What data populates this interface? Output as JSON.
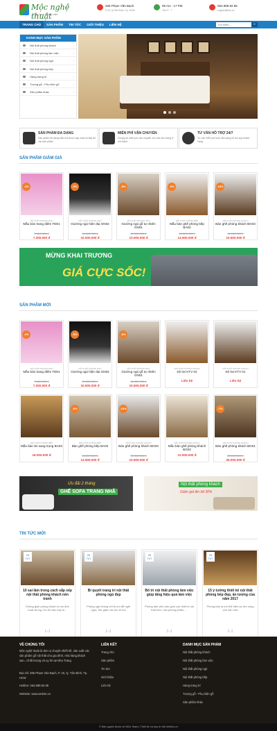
{
  "header": {
    "logo_text": "Mộc nghệ thuật",
    "slogan": "Tinh hoa đồ thủ việt",
    "address": "265 Phạm Văn Bạch",
    "address_sub": "P.15, Q.Tân Bình, Tp. HCM",
    "hours": "09 Am : 17 PM",
    "hours_sub": "Thứ 2 - 7",
    "phone": "064.989.92.95",
    "email": "support@nlo.vn"
  },
  "nav": {
    "items": [
      "TRANG CHỦ",
      "SẢN PHẨM",
      "TIN TỨC",
      "GIỚI THIỆU",
      "LIÊN HỆ"
    ],
    "search_placeholder": "Tìm kiếm..."
  },
  "sidebar": {
    "title": "DANH MỤC SẢN PHẨM",
    "items": [
      "Nội thất phòng khách",
      "Nội thất phòng làm việc",
      "Nội thất phòng ngủ",
      "Nội thất phòng bếp",
      "Hàng trang trí",
      "Tượng gỗ - Phụ kiện gỗ",
      "Sản phẩm khác"
    ]
  },
  "features": [
    {
      "title": "SẢN PHẨM ĐA DẠNG",
      "desc": "Sản phẩm đa dạng mẫu mã được cập nhật và đầy đủ các sản phẩm"
    },
    {
      "title": "MIỄN PHÍ VẬN CHUYỂN",
      "desc": "Chúng tôi miễn phí vận chuyển cho các đơn hàng ở nội thành"
    },
    {
      "title": "TƯ VẤN HỖ TRỢ 24/7",
      "desc": "Tư vấn miễn phí luôn sẵn sàng hỗ trợ quý khách hàng"
    }
  ],
  "sale_section": {
    "title": "SẢN PHẨM GIẢM GIÁ",
    "products": [
      {
        "badge": "-4%",
        "cat": "NỘI THẤT PHÒNG NGỦ",
        "name": "Mẫu bàn trang điểm TĐ01",
        "old": "7.500.000 đ",
        "price": "7.200.000 đ"
      },
      {
        "badge": "-9%",
        "cat": "NỘI THẤT PHÒNG NGỦ",
        "name": "Giường ngủ hiện đại GN02",
        "old": "11.000.000 đ",
        "price": "10.000.000 đ"
      },
      {
        "badge": "-8%",
        "cat": "NỘI THẤT PHÒNG NGỦ",
        "name": "Giường ngủ gỗ tự nhiên GN01",
        "old": "11.500.000 đ",
        "price": "10.500.000 đ"
      },
      {
        "badge": "-6%",
        "cat": "NỘI THẤT PHÒNG BẾP",
        "name": "Mẫu bàn ghế phòng bếp BA02",
        "old": "14.500.000 đ",
        "price": "13.500.000 đ"
      },
      {
        "badge": "-10%",
        "cat": "NỘI THẤT PHÒNG KHÁCH",
        "name": "Bàn ghế phòng khách BG03",
        "old": "11.000.000 đ",
        "price": "10.500.000 đ"
      }
    ]
  },
  "banner": {
    "line1": "MỪNG KHAI TRƯƠNG",
    "line2": "GIÁ CỰC SỐC!"
  },
  "new_section": {
    "title": "SẢN PHẨM MỚI",
    "row1": [
      {
        "badge": "-4%",
        "cat": "NỘI THẤT PHÒNG NGỦ",
        "name": "Mẫu bàn trang điểm TĐ01",
        "old": "7.500.000 đ",
        "price": "7.200.000 đ"
      },
      {
        "badge": "-9%",
        "cat": "NỘI THẤT PHÒNG NGỦ",
        "name": "Giường ngủ hiện đại GN02",
        "old": "11.000.000 đ",
        "price": "10.000.000 đ"
      },
      {
        "badge": "-8%",
        "cat": "NỘI THẤT PHÒNG NGỦ",
        "name": "Giường ngủ gỗ tự nhiên GN01",
        "old": "11.500.000 đ",
        "price": "10.500.000 đ"
      },
      {
        "badge": "",
        "cat": "NỘI THẤT PHÒNG KHÁCH",
        "name": "Kệ tivi KTV 02",
        "old": "",
        "price": "Liên hệ"
      },
      {
        "badge": "",
        "cat": "NỘI THẤT PHÒNG KHÁCH",
        "name": "Kệ tivi KTV 01",
        "old": "",
        "price": "Liên hệ"
      }
    ],
    "row2": [
      {
        "badge": "",
        "cat": "NỘI THẤT PHÒNG BẾP",
        "name": "Mẫu bàn ăn sang trọng BA03",
        "old": "",
        "price": "16.000.000 đ"
      },
      {
        "badge": "-6%",
        "cat": "NỘI THẤT PHÒNG BẾP",
        "name": "Bàn ghế phòng bếp BA02",
        "old": "14.500.000 đ",
        "price": "13.500.000 đ"
      },
      {
        "badge": "-10%",
        "cat": "NỘI THẤT PHÒNG KHÁCH",
        "name": "Bàn ghế phòng khách BG03",
        "old": "11.000.000 đ",
        "price": "10.500.000 đ"
      },
      {
        "badge": "",
        "cat": "NỘI THẤT PHÒNG KHÁCH",
        "name": "Mẫu bàn ghế phòng khách BG02",
        "old": "",
        "price": "12.000.000 đ"
      },
      {
        "badge": "-7%",
        "cat": "NỘI THẤT PHÒNG KHÁCH",
        "name": "Bàn ghế phòng khách BG01",
        "old": "28.000.000 đ",
        "price": "26.000.000 đ"
      }
    ]
  },
  "ads": [
    {
      "line1": "Ưu đãi 2 tháng",
      "line2": "GHẾ SOFA TRANG NHÃ"
    },
    {
      "line1": "Nội thất phòng khách",
      "line2": "Giảm giá lên tới 30%"
    }
  ],
  "news_section": {
    "title": "TIN TỨC MỚI",
    "items": [
      {
        "day": "25",
        "month": "Th7",
        "title": "10 sai lầm trong cách sắp xếp nội thất phòng khách nên tránh",
        "desc": "Không gian phòng khách là nơi lịnh hoạt chung. Do đó việc bày trí...",
        "more": "[...]"
      },
      {
        "day": "25",
        "month": "Th7",
        "title": "Bí quyết trang trí nội thất phòng ngủ đẹp",
        "desc": "Phòng ngủ không chỉ là nơi để nghỉ ngơi, thư giãn mà còn là nơi",
        "more": "[...]"
      },
      {
        "day": "25",
        "month": "Th7",
        "title": "Bố trí nội thất phòng làm việc giúp tăng hiệu quả làm việc",
        "desc": "Phòng làm việc bao gồm các thiết bị nội thất như: văn phòng phẩm, ...",
        "more": "[...]"
      },
      {
        "day": "25",
        "month": "Th7",
        "title": "15 ý tưởng thiết kế nội thất phòng bếp đẹp, ấn tượng của năm 2017",
        "desc": "Phòng bếp là nơi thể hiện sự ấm cúng cho căn nhà",
        "more": "[...]"
      }
    ]
  },
  "footer": {
    "about_title": "VỀ CHÚNG TÔI",
    "about_text": "Mộc nghệ thuật là đơn vị chuyên thiết kế, sản xuất các sản phẩm gỗ nội thất cho gia đình, nhà hàng,khách sạn...Chất lượng và uy tín tại Nha Trang.",
    "address": "Địa chỉ: 265 Phạm Văn Bạch, P. 15, Q. Tân Bình, Tp. HCM",
    "hotline": "Hotline: 064.989.92.95",
    "website": "Website: www.web2s.vn",
    "links_title": "LIÊN KẾT",
    "links": [
      "Trang chủ",
      "Sản phẩm",
      "Tin tức",
      "Giới thiệu",
      "Liên hệ"
    ],
    "cats_title": "DANH MỤC SẢN PHẨM",
    "cats": [
      "Nội thất phòng khách",
      "Nội thất phòng làm việc",
      "Nội thất phòng ngủ",
      "Nội thất phòng bếp",
      "Hàng trang trí",
      "Tượng gỗ - Phụ kiện gỗ",
      "Sản phẩm khác"
    ],
    "copyright": "© Bản quyền thuộc về W2s Team | Thiết kế và duy trì bởi Web2s.vn"
  },
  "colors": {
    "primary": "#1f7fc5",
    "sale_badge": "#f07f2a",
    "price": "#e53935",
    "footer_bg": "#1c1915",
    "banner": "#2aa35a"
  }
}
